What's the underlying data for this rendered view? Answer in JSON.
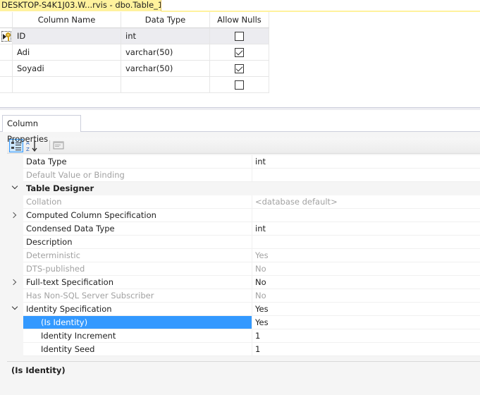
{
  "document_tab": {
    "title": "DESKTOP-S4K1J03.W...rvis - dbo.Table_1*"
  },
  "designer": {
    "headers": [
      "Column Name",
      "Data Type",
      "Allow Nulls"
    ],
    "rows": [
      {
        "name": "ID",
        "type": "int",
        "allow_nulls": false,
        "primary_key": true,
        "current": true
      },
      {
        "name": "Adi",
        "type": "varchar(50)",
        "allow_nulls": true
      },
      {
        "name": "Soyadi",
        "type": "varchar(50)",
        "allow_nulls": true
      },
      {
        "name": "",
        "type": "",
        "allow_nulls": false
      }
    ]
  },
  "properties_tab": {
    "label": "Column Properties"
  },
  "toolbar": {
    "categorized_icon": "categorized-icon",
    "alphabetical_icon": "sort-alphabetical-icon",
    "property_pages_icon": "property-pages-icon"
  },
  "property_rows": [
    {
      "name": "Data Type",
      "value": "int",
      "level": 1
    },
    {
      "name": "Default Value or Binding",
      "value": "",
      "level": 1,
      "disabled": true
    },
    {
      "name": "Table Designer",
      "value": "",
      "category": true,
      "expander": "down"
    },
    {
      "name": "Collation",
      "value": "<database default>",
      "level": 1,
      "disabled": true
    },
    {
      "name": "Computed Column Specification",
      "value": "",
      "level": 1,
      "expander": "right"
    },
    {
      "name": "Condensed Data Type",
      "value": "int",
      "level": 1
    },
    {
      "name": "Description",
      "value": "",
      "level": 1
    },
    {
      "name": "Deterministic",
      "value": "Yes",
      "level": 1,
      "disabled": true
    },
    {
      "name": "DTS-published",
      "value": "No",
      "level": 1,
      "disabled": true
    },
    {
      "name": "Full-text Specification",
      "value": "No",
      "level": 1,
      "expander": "right"
    },
    {
      "name": "Has Non-SQL Server Subscriber",
      "value": "No",
      "level": 1,
      "disabled": true
    },
    {
      "name": "Identity Specification",
      "value": "Yes",
      "level": 1,
      "expander": "down"
    },
    {
      "name": "(Is Identity)",
      "value": "Yes",
      "level": 2,
      "selected": true
    },
    {
      "name": "Identity Increment",
      "value": "1",
      "level": 2
    },
    {
      "name": "Identity Seed",
      "value": "1",
      "level": 2
    }
  ],
  "description": {
    "title": "(Is Identity)"
  },
  "colors": {
    "selection": "#3399ff",
    "tab_active": "#fff29d",
    "disabled_text": "#a2a2a2"
  }
}
